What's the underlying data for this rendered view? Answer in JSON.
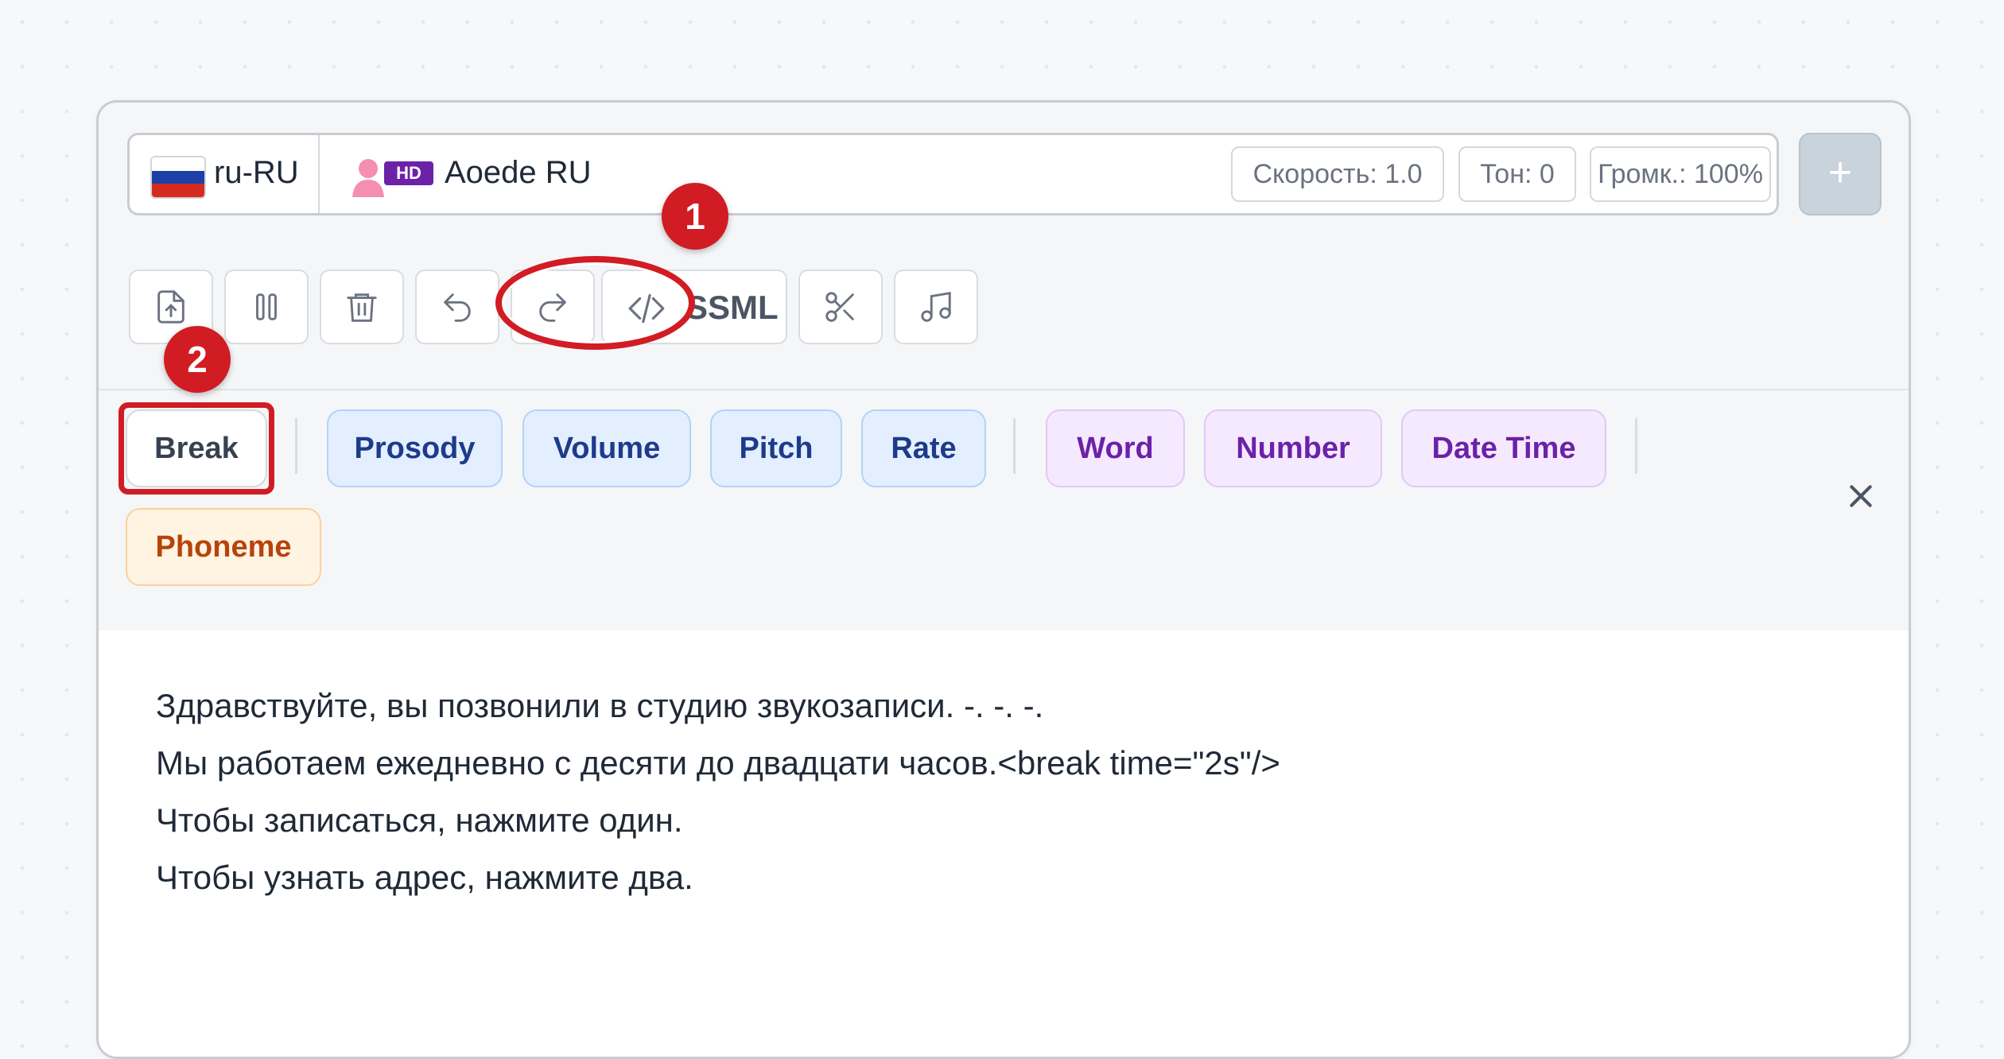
{
  "voice_bar": {
    "language": "ru-RU",
    "badge": "HD",
    "voice": "Aoede RU",
    "speed": "Скорость: 1.0",
    "tone": "Тон: 0",
    "volume": "Громк.: 100%",
    "add": "+"
  },
  "toolbar": {
    "ssml_label": "SSML",
    "buttons": [
      "upload-icon",
      "pause-icon",
      "trash-icon",
      "undo-icon",
      "redo-icon",
      "code-icon",
      "scissors-icon",
      "music-icon"
    ]
  },
  "tags": {
    "break": "Break",
    "prosody": "Prosody",
    "volume": "Volume",
    "pitch": "Pitch",
    "rate": "Rate",
    "word": "Word",
    "number": "Number",
    "datetime": "Date Time",
    "phoneme": "Phoneme",
    "close": "×"
  },
  "markers": {
    "one": "1",
    "two": "2"
  },
  "editor": {
    "lines": [
      "Здравствуйте, вы позвонили в студию звукозаписи. -. -. -.",
      "Мы работаем ежедневно с десяти до двадцати часов.<break time=\"2s\"/>",
      "Чтобы записаться, нажмите один.",
      "Чтобы узнать адрес, нажмите два."
    ]
  },
  "colors": {
    "accent_red": "#d11c24",
    "blue_tag": "#1e3a8a",
    "purple_tag": "#6b21a8",
    "orange_tag": "#b8430a"
  }
}
